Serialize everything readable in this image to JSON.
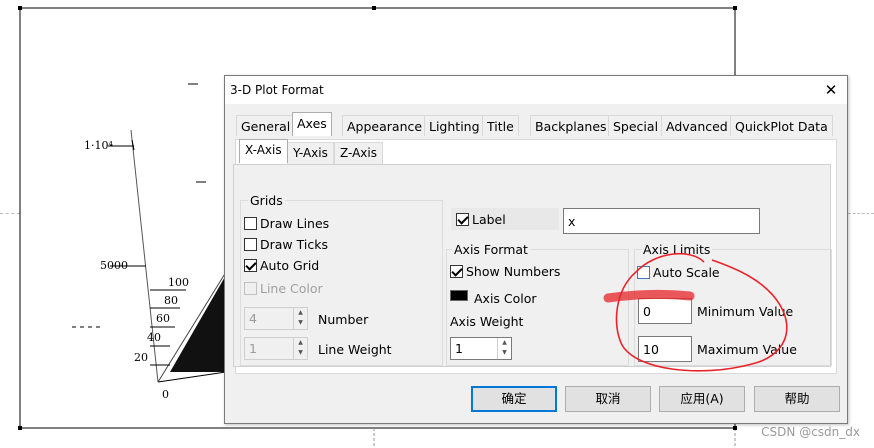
{
  "plot": {
    "z_tick_top": "1·10⁴",
    "z_tick_mid": "5000",
    "z_tick_zero": "0",
    "y_ticks": [
      "100",
      "80",
      "60",
      "40",
      "20"
    ]
  },
  "dialog": {
    "title": "3-D Plot Format",
    "close_glyph": "✕",
    "tabs": [
      "General",
      "Axes",
      "Appearance",
      "Lighting",
      "Title",
      "Backplanes",
      "Special",
      "Advanced",
      "QuickPlot Data"
    ],
    "active_tab": "Axes",
    "subtabs": [
      "X-Axis",
      "Y-Axis",
      "Z-Axis"
    ],
    "active_subtab": "X-Axis"
  },
  "grids": {
    "title": "Grids",
    "draw_lines": {
      "label": "Draw Lines",
      "checked": false
    },
    "draw_ticks": {
      "label": "Draw Ticks",
      "checked": false
    },
    "auto_grid": {
      "label": "Auto Grid",
      "checked": true
    },
    "line_color": {
      "label": "Line Color",
      "checked": false,
      "disabled": true
    },
    "number": {
      "label": "Number",
      "value": "4"
    },
    "line_weight": {
      "label": "Line Weight",
      "value": "1"
    }
  },
  "label_row": {
    "label": "Label",
    "checked": true,
    "value": "x"
  },
  "axis_format": {
    "title": "Axis Format",
    "show_numbers": {
      "label": "Show Numbers",
      "checked": true
    },
    "axis_color": {
      "label": "Axis Color",
      "swatch": "#000000"
    },
    "axis_weight": {
      "label": "Axis Weight",
      "value": "1"
    }
  },
  "axis_limits": {
    "title": "Axis Limits",
    "auto_scale": {
      "label": "Auto Scale",
      "checked": false
    },
    "minimum": {
      "label": "Minimum Value",
      "value": "0"
    },
    "maximum": {
      "label": "Maximum Value",
      "value": "10"
    }
  },
  "buttons": {
    "ok": "确定",
    "cancel": "取消",
    "apply": "应用(A)",
    "help": "帮助"
  },
  "annotation_color": "#e8242a",
  "watermark": "CSDN @csdn_dx"
}
